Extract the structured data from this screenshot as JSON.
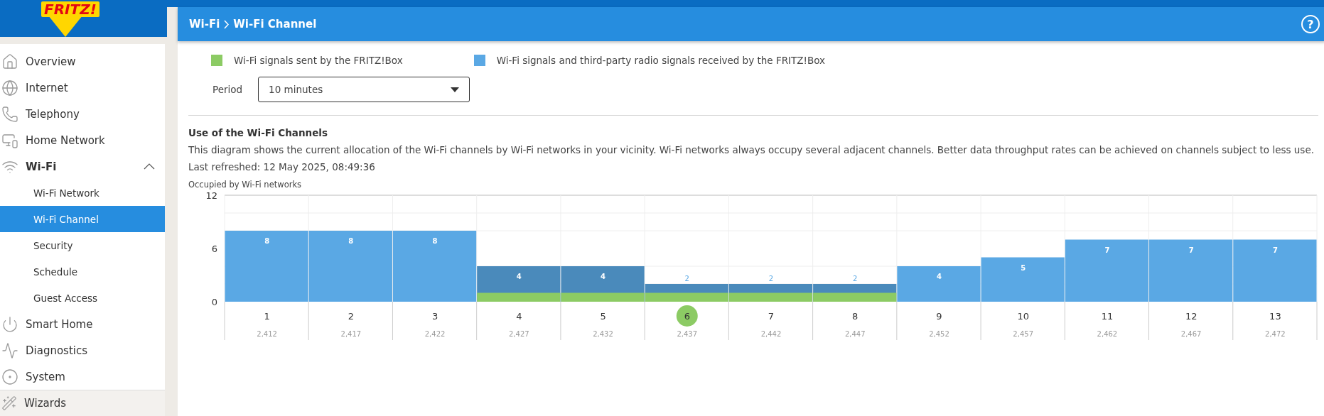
{
  "header": {
    "logo": "FRITZ!",
    "breadcrumb": [
      "Wi-Fi",
      "Wi-Fi Channel"
    ],
    "help": "?"
  },
  "sidebar": {
    "items": [
      {
        "label": "Overview",
        "selected": false
      },
      {
        "label": "Internet",
        "selected": false
      },
      {
        "label": "Telephony",
        "selected": false
      },
      {
        "label": "Home Network",
        "selected": false
      },
      {
        "label": "Wi-Fi",
        "selected": true,
        "expanded": true,
        "children": [
          {
            "label": "Wi-Fi Network",
            "selected": false
          },
          {
            "label": "Wi-Fi Channel",
            "selected": true
          },
          {
            "label": "Security",
            "selected": false
          },
          {
            "label": "Schedule",
            "selected": false
          },
          {
            "label": "Guest Access",
            "selected": false
          }
        ]
      },
      {
        "label": "Smart Home",
        "selected": false
      },
      {
        "label": "Diagnostics",
        "selected": false
      },
      {
        "label": "System",
        "selected": false
      }
    ],
    "footer": "Wizards"
  },
  "period": {
    "label": "Period",
    "value": "10 minutes"
  },
  "section": {
    "title": "Use of the Wi-Fi Channels",
    "description": "This diagram shows the current allocation of the Wi-Fi channels by Wi-Fi networks in your vicinity. Wi-Fi networks always occupy several adjacent channels. Better data throughput rates can be achieved on channels subject to less use.",
    "refreshed": "Last refreshed: 12 May 2025, 08:49:36"
  },
  "chart": {
    "frequencies": [
      {
        "label": "2,412",
        "selected": false
      },
      {
        "label": "2,417",
        "selected": false
      },
      {
        "label": "2,422",
        "selected": false
      },
      {
        "label": "2,427",
        "selected": false
      },
      {
        "label": "2,432",
        "selected": false
      },
      {
        "label": "2,437",
        "selected": true
      },
      {
        "label": "2,442",
        "selected": false
      },
      {
        "label": "2,447",
        "selected": false
      },
      {
        "label": "2,452",
        "selected": false
      },
      {
        "label": "2,457",
        "selected": false
      },
      {
        "label": "2,462",
        "selected": false
      },
      {
        "label": "2,467",
        "selected": false
      },
      {
        "label": "2,472",
        "selected": false
      }
    ],
    "chart_data": {
      "type": "bar",
      "ylabel": "Occupied by Wi-Fi networks",
      "categories": [
        "1",
        "2",
        "3",
        "4",
        "5",
        "6",
        "7",
        "8",
        "9",
        "10",
        "11",
        "12",
        "13"
      ],
      "stacked": false,
      "ylim": [
        0,
        12
      ],
      "yticks": [
        0,
        6,
        12
      ],
      "series": [
        {
          "name": "Wi-Fi signals sent by the FRITZ!Box",
          "color": "#8ccb64",
          "values": [
            0,
            0,
            0,
            1,
            1,
            1,
            1,
            1,
            0,
            0,
            0,
            0,
            0
          ]
        },
        {
          "name": "Wi-Fi signals and third-party radio signals received by the FRITZ!Box",
          "color": "#5aa8e4",
          "values": [
            8,
            8,
            8,
            4,
            4,
            2,
            2,
            2,
            4,
            5,
            7,
            7,
            7
          ]
        }
      ],
      "value_labels": [
        [
          null,
          null,
          null,
          null,
          null,
          null,
          null,
          null,
          null,
          null,
          null,
          null,
          null
        ],
        [
          "8",
          "8",
          "8",
          "4",
          "4",
          "2",
          "2",
          "2",
          "4",
          "5",
          "7",
          "7",
          "7"
        ]
      ]
    }
  }
}
